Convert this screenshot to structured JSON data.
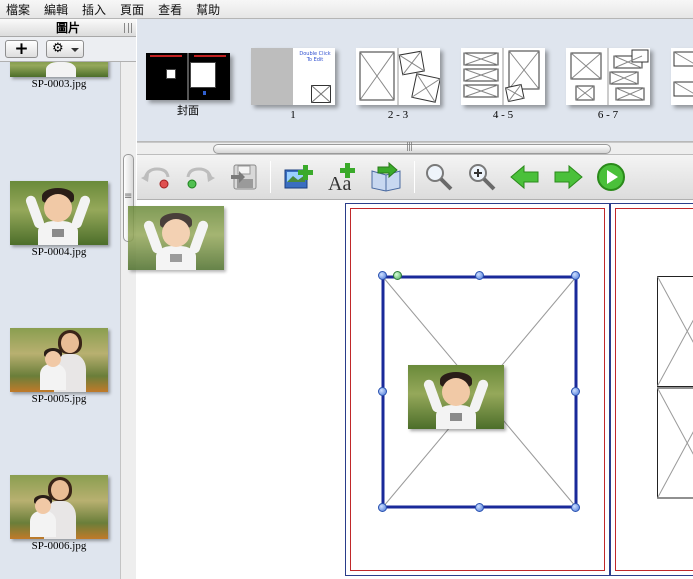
{
  "menu": [
    "檔案",
    "編輯",
    "插入",
    "頁面",
    "查看",
    "幫助"
  ],
  "left_panel": {
    "title": "圖片",
    "add_button": "+",
    "gear_button": "⚙",
    "photos": [
      {
        "name": "SP-0003.jpg"
      },
      {
        "name": "SP-0004.jpg"
      },
      {
        "name": "SP-0005.jpg"
      },
      {
        "name": "SP-0006.jpg"
      }
    ]
  },
  "pages": [
    {
      "label": "封面"
    },
    {
      "label": "1",
      "cover_text": "Double Click\nTo Edit"
    },
    {
      "label": "2 - 3"
    },
    {
      "label": "4 - 5"
    },
    {
      "label": "6 - 7"
    }
  ],
  "toolbar_icons": [
    "undo-icon",
    "redo-icon",
    "save-icon",
    "add-photo-icon",
    "add-text-icon",
    "add-page-icon",
    "zoom-out-icon",
    "zoom-in-icon",
    "previous-page-arrow-icon",
    "next-page-arrow-icon",
    "play-preview-icon"
  ],
  "colors": {
    "selection": "#1a2a9a",
    "page_border": "#2a3d8a",
    "margin_line": "#c0282a",
    "arrow_green": "#3aaa2a"
  }
}
